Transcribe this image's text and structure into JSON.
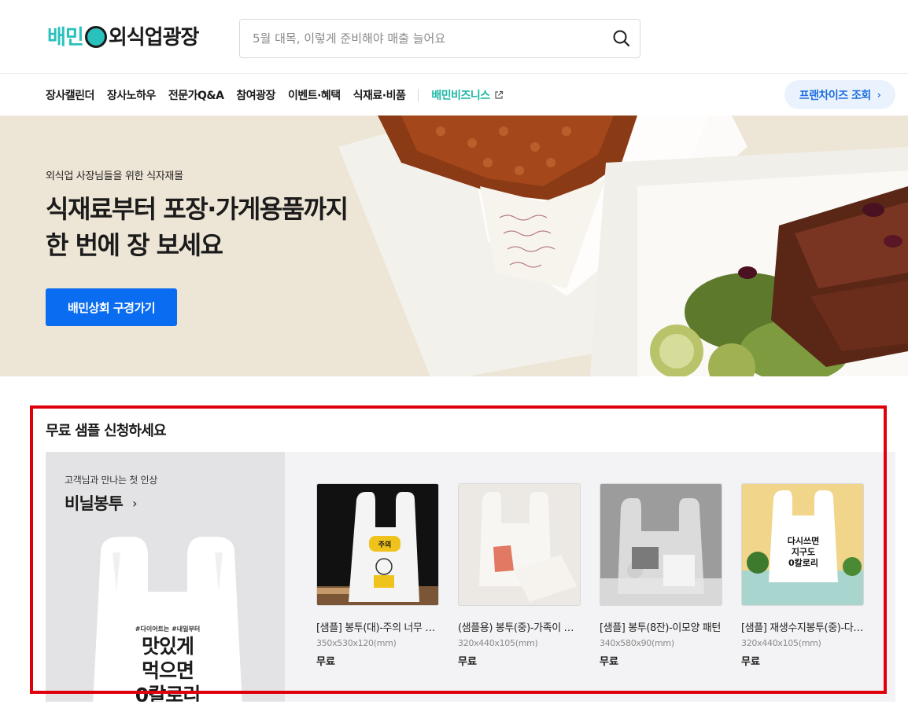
{
  "header": {
    "logo": {
      "part1": "배민",
      "part2": "외식업광장"
    },
    "search": {
      "placeholder": "5월 대목, 이렇게 준비해야 매출 늘어요",
      "value": ""
    }
  },
  "nav": {
    "items": [
      {
        "label": "장사캘린더"
      },
      {
        "label": "장사노하우"
      },
      {
        "label": "전문가Q&A"
      },
      {
        "label": "참여광장"
      },
      {
        "label": "이벤트·혜택"
      },
      {
        "label": "식재료·비품"
      }
    ],
    "external": {
      "label": "배민비즈니스"
    },
    "franchise_button": "프랜차이즈 조회",
    "franchise_chevron": "›"
  },
  "hero": {
    "subtitle": "외식업 사장님들을 위한 식자재몰",
    "title_line1": "식재료부터 포장·가게용품까지",
    "title_line2": "한 번에 장 보세요",
    "cta": "배민상회 구경가기"
  },
  "samples": {
    "section_title": "무료 샘플 신청하세요",
    "feature": {
      "subtitle": "고객님과 만나는 첫 인상",
      "title": "비닐봉투",
      "chevron": "›",
      "bag_tag": "#다이어트는 #내일부터",
      "bag_copy": [
        "맛있게",
        "먹으면",
        "0칼로리"
      ]
    },
    "products": [
      {
        "name": "[샘플] 봉투(대)-주의 너무 맛있음",
        "size": "350x530x120(mm)",
        "price": "무료",
        "bag_label": "주의"
      },
      {
        "name": "(샘플용) 봉투(중)-가족이 함께",
        "size": "320x440x105(mm)",
        "price": "무료"
      },
      {
        "name": "[샘플] 봉투(8잔)-이모양 패턴",
        "size": "340x580x90(mm)",
        "price": "무료"
      },
      {
        "name": "[샘플] 재생수지봉투(중)-다시쓰면",
        "size": "320x440x105(mm)",
        "price": "무료",
        "bag_label": [
          "다시쓰면",
          "지구도",
          "0칼로리"
        ]
      }
    ]
  },
  "colors": {
    "brand_mint": "#2ac1bc",
    "cta_blue": "#0a6cf0",
    "franchise_text": "#1f6fe0",
    "hero_bg": "#ede5d5",
    "highlight_red": "#e0000b"
  }
}
